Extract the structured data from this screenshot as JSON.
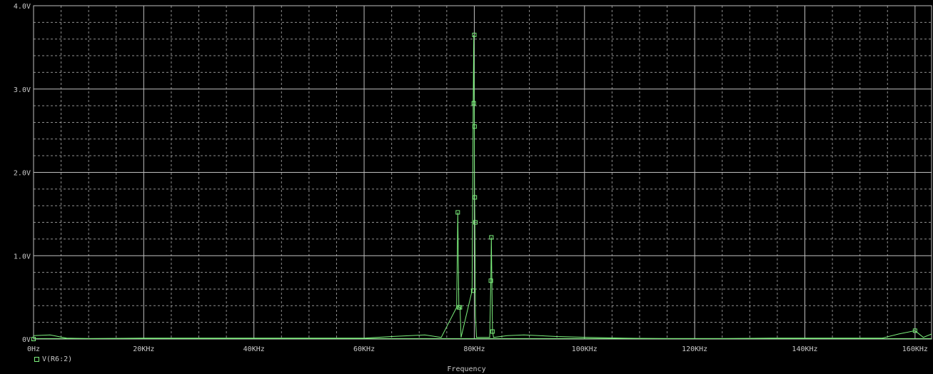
{
  "chart_data": {
    "type": "line",
    "title": "",
    "xlabel": "Frequency",
    "ylabel": "",
    "xlim": [
      0,
      163000
    ],
    "ylim": [
      0,
      4.0
    ],
    "x_tick_labels": [
      "0Hz",
      "20KHz",
      "40KHz",
      "60KHz",
      "80KHz",
      "100KHz",
      "120KHz",
      "140KHz",
      "160KHz"
    ],
    "x_tick_values": [
      0,
      20000,
      40000,
      60000,
      80000,
      100000,
      120000,
      140000,
      160000
    ],
    "y_tick_labels": [
      "0V",
      "1.0V",
      "2.0V",
      "3.0V",
      "4.0V"
    ],
    "y_tick_values": [
      0,
      1,
      2,
      3,
      4
    ],
    "grid": true,
    "colors": {
      "background": "#000000",
      "trace": "#7cf07c",
      "grid": "#bfbfbf",
      "text": "#c8c8c8"
    },
    "series": [
      {
        "name": "V(R6:2)",
        "x": [
          0,
          3000,
          6000,
          10000,
          20000,
          30000,
          40000,
          47000,
          60000,
          65000,
          71000,
          74000,
          76800,
          77000,
          77200,
          77400,
          77600,
          79600,
          79800,
          79900,
          80000,
          80050,
          80100,
          80200,
          80400,
          82800,
          83000,
          83100,
          83300,
          83500,
          86000,
          89000,
          95000,
          101000,
          107000,
          115000,
          125000,
          134000,
          140000,
          154000,
          157000,
          160000,
          161500,
          163000
        ],
        "y": [
          0.04,
          0.05,
          0.01,
          0.005,
          0.01,
          0.01,
          0.01,
          0.01,
          0.01,
          0.03,
          0.05,
          0.02,
          0.38,
          1.52,
          0.38,
          0.38,
          0.02,
          0.58,
          2.83,
          3.65,
          2.55,
          1.7,
          1.4,
          0.28,
          0.02,
          0.02,
          0.7,
          1.22,
          0.09,
          0.02,
          0.04,
          0.05,
          0.03,
          0.02,
          0.01,
          0.005,
          0.005,
          0.01,
          0.01,
          0.01,
          0.06,
          0.1,
          0.02,
          0.06
        ]
      }
    ],
    "marker_points_x": [
      0,
      77000,
      77200,
      77400,
      79800,
      79900,
      80000,
      80050,
      80100,
      80200,
      83000,
      83100,
      83300,
      160000
    ],
    "marker_points_y": [
      0,
      1.52,
      0.38,
      0.38,
      0.58,
      2.83,
      3.65,
      2.55,
      1.7,
      1.4,
      0.7,
      1.22,
      0.09,
      0.1
    ]
  },
  "legend": {
    "label": "V(R6:2)"
  },
  "axis": {
    "xlabel": "Frequency"
  }
}
